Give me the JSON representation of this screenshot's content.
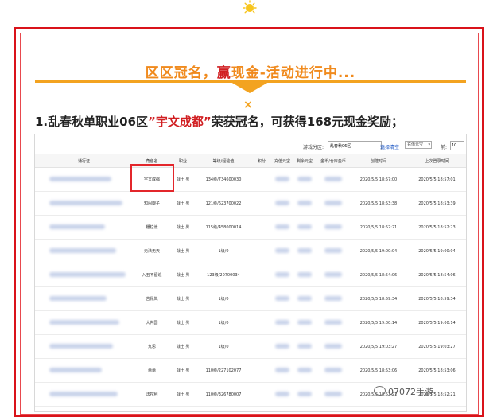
{
  "header": {
    "headline_part1": "区区冠名，",
    "headline_accent": "赢",
    "headline_part2": "现金-活动进行中...",
    "cross": "×"
  },
  "award": {
    "prefix": "1.乱春秋单职业06区",
    "open_quote": "”",
    "name": "宇文成都",
    "close_quote": "”",
    "suffix": "荣获冠名，可获得168元现金奖励；"
  },
  "filter": {
    "server_label": "游戏分区:",
    "server_value": "乱春秋06区",
    "select_link": "选择",
    "clear_link": "清空",
    "sort_value": "充值元宝",
    "count_label": "前:",
    "count_value": "10"
  },
  "table": {
    "columns": [
      "通行证",
      "角色名",
      "职业",
      "等级/经验值",
      "积分",
      "充值元宝",
      "剩余元宝",
      "金币/仓库金币",
      "创建时间",
      "上次登录时间"
    ],
    "rows": [
      {
        "name": "宇文成都",
        "job": "战士",
        "level": "134级/734600030",
        "created": "2020/5/5 18:57:00",
        "last": "2020/5/5 18:57:01"
      },
      {
        "name": "知闷瓣子",
        "job": "战士",
        "level": "121级/623700022",
        "created": "2020/5/5 18:53:38",
        "last": "2020/5/5 18:53:39"
      },
      {
        "name": "栅栏诡",
        "job": "战士",
        "level": "115级/458000014",
        "created": "2020/5/5 18:52:21",
        "last": "2020/5/5 18:52:23"
      },
      {
        "name": "无法无天",
        "job": "战士",
        "level": "1级/0",
        "created": "2020/5/5 19:00:04",
        "last": "2020/5/5 19:00:04"
      },
      {
        "name": "入丑不留追",
        "job": "战士",
        "level": "123级/20700034",
        "created": "2020/5/5 18:54:06",
        "last": "2020/5/5 18:54:06"
      },
      {
        "name": "苦昆岚",
        "job": "战士",
        "level": "1级/0",
        "created": "2020/5/5 18:59:34",
        "last": "2020/5/5 18:59:34"
      },
      {
        "name": "大判国",
        "job": "战士",
        "level": "1级/0",
        "created": "2020/5/5 19:00:14",
        "last": "2020/5/5 19:00:14"
      },
      {
        "name": "九思",
        "job": "战士",
        "level": "1级/0",
        "created": "2020/5/5 19:03:27",
        "last": "2020/5/5 19:03:27"
      },
      {
        "name": "蕾蕾",
        "job": "战士",
        "level": "110级/227102077",
        "created": "2020/5/5 18:53:06",
        "last": "2020/5/5 18:53:06"
      },
      {
        "name": "法控利",
        "job": "战士",
        "level": "110级/326780007",
        "created": "2020/5/5 18:52:21",
        "last": "2020/5/5 18:52:21"
      }
    ],
    "job_sub": "男"
  },
  "watermark": {
    "text": "07072手游"
  },
  "colors": {
    "accent_orange": "#f08a1d",
    "accent_red": "#d11f22",
    "frame_red": "#d9131a"
  }
}
